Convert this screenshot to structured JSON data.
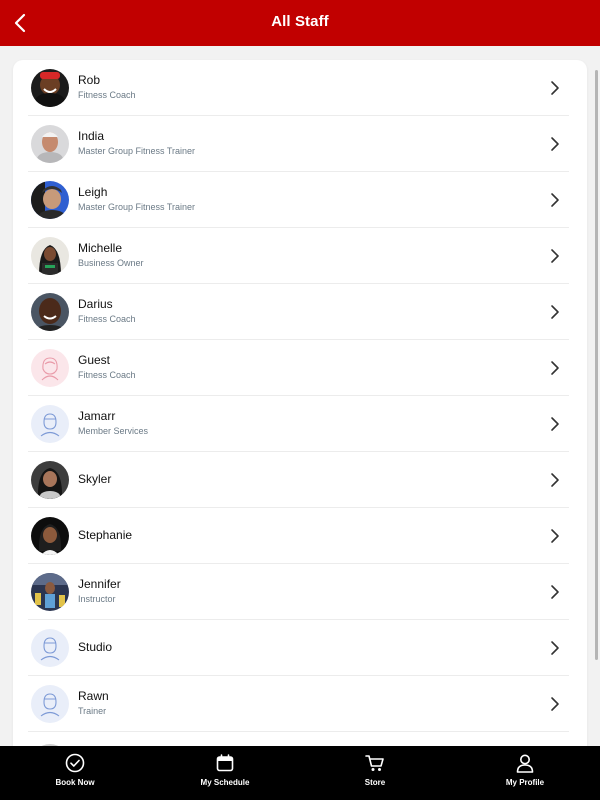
{
  "header": {
    "title": "All Staff",
    "back_icon": "chevron-left-icon"
  },
  "colors": {
    "brand": "#c10000",
    "tab_bar": "#000000",
    "role_text": "#6b7a86"
  },
  "staff": [
    {
      "name": "Rob",
      "role": "Fitness Coach",
      "avatar": "photo"
    },
    {
      "name": "India",
      "role": "Master Group Fitness Trainer",
      "avatar": "photo"
    },
    {
      "name": "Leigh",
      "role": "Master Group Fitness Trainer",
      "avatar": "photo"
    },
    {
      "name": "Michelle",
      "role": "Business Owner",
      "avatar": "photo"
    },
    {
      "name": "Darius",
      "role": "Fitness Coach",
      "avatar": "photo"
    },
    {
      "name": "Guest",
      "role": "Fitness Coach",
      "avatar": "female-placeholder-icon"
    },
    {
      "name": "Jamarr",
      "role": "Member Services",
      "avatar": "male-placeholder-icon"
    },
    {
      "name": "Skyler",
      "role": "",
      "avatar": "photo"
    },
    {
      "name": "Stephanie",
      "role": "",
      "avatar": "photo"
    },
    {
      "name": "Jennifer",
      "role": "Instructor",
      "avatar": "photo"
    },
    {
      "name": "Studio",
      "role": "",
      "avatar": "male-placeholder-icon"
    },
    {
      "name": "Rawn",
      "role": "Trainer",
      "avatar": "male-placeholder-icon"
    }
  ],
  "tabs": [
    {
      "label": "Book Now",
      "icon": "check-circle-icon"
    },
    {
      "label": "My Schedule",
      "icon": "calendar-icon"
    },
    {
      "label": "Store",
      "icon": "cart-icon"
    },
    {
      "label": "My Profile",
      "icon": "user-icon"
    }
  ]
}
